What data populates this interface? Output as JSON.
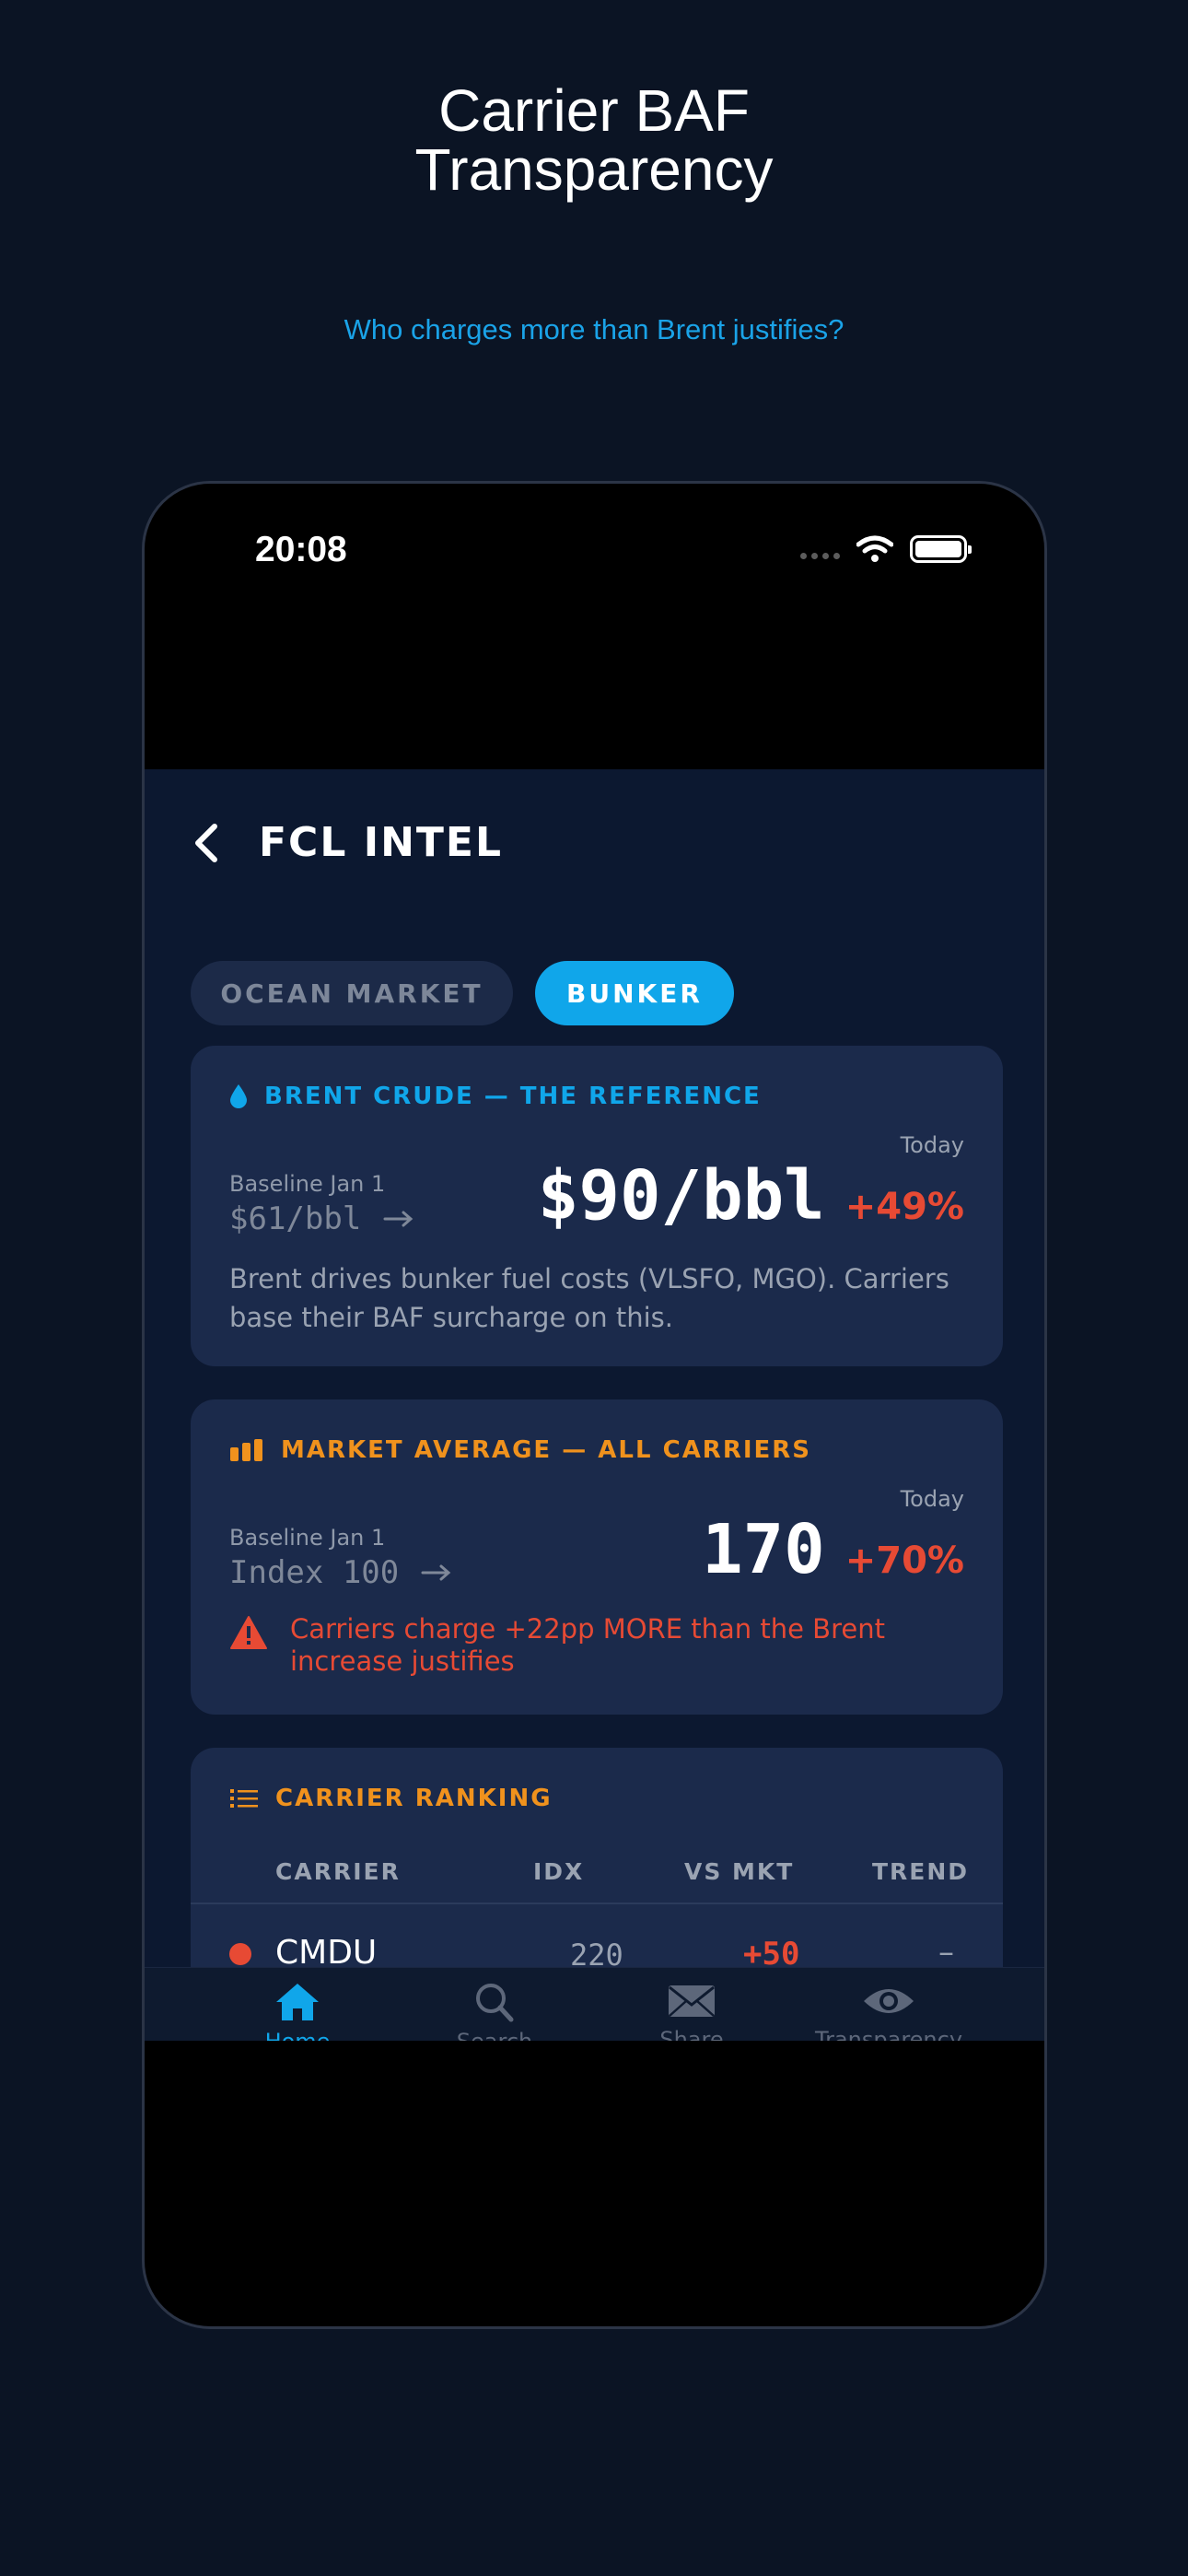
{
  "promo": {
    "title_line1": "Carrier BAF",
    "title_line2": "Transparency",
    "subtitle": "Who charges more than Brent justifies?"
  },
  "status_bar": {
    "time": "20:08"
  },
  "nav": {
    "title": "FCL INTEL"
  },
  "segments": [
    {
      "label": "OCEAN MARKET",
      "selected": false
    },
    {
      "label": "BUNKER",
      "selected": true
    }
  ],
  "brent_card": {
    "header": "BRENT CRUDE — THE REFERENCE",
    "icon": "droplet-icon",
    "today_label": "Today",
    "baseline_label": "Baseline Jan 1",
    "baseline_value": "$61/bbl",
    "current_value": "$90/bbl",
    "change": "+49%",
    "description": "Brent drives bunker fuel costs (VLSFO, MGO). Carriers base their BAF surcharge on this."
  },
  "market_card": {
    "header": "MARKET AVERAGE — ALL CARRIERS",
    "icon": "bar-chart-icon",
    "today_label": "Today",
    "baseline_label": "Baseline Jan 1",
    "baseline_value": "Index 100",
    "current_value": "170",
    "change": "+70%",
    "warning": "Carriers charge +22pp MORE than the Brent increase justifies"
  },
  "ranking_card": {
    "header": "CARRIER RANKING",
    "icon": "list-icon",
    "columns": [
      "CARRIER",
      "IDX",
      "VS MKT",
      "TREND"
    ],
    "rows": [
      {
        "carrier": "CMDU",
        "idx": "220",
        "vs_mkt": "+50",
        "trend": "–"
      }
    ]
  },
  "tabbar": {
    "items": [
      {
        "label": "Home",
        "icon": "home-icon",
        "active": true
      },
      {
        "label": "Search",
        "icon": "search-icon",
        "active": false
      },
      {
        "label": "Share",
        "icon": "envelope-icon",
        "active": false
      },
      {
        "label": "Transparency",
        "icon": "eye-icon",
        "active": false
      }
    ]
  },
  "colors": {
    "background": "#0b1424",
    "accent_blue": "#10a6ea",
    "accent_orange": "#f0921d",
    "alert_red": "#e74a34",
    "card": "#1b2a4b"
  }
}
